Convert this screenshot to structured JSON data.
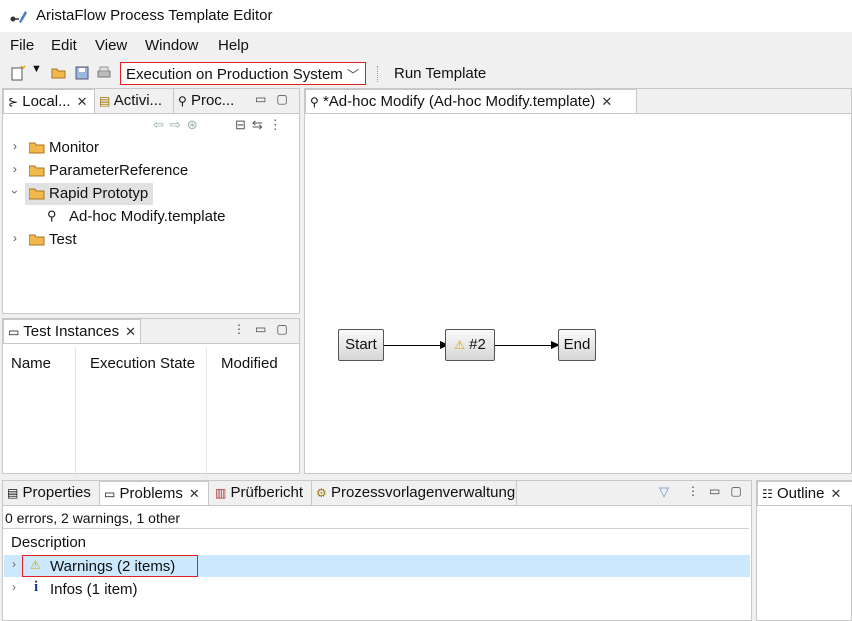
{
  "window": {
    "title": "AristaFlow Process Template Editor"
  },
  "menu": [
    "File",
    "Edit",
    "View",
    "Window",
    "Help"
  ],
  "toolbar": {
    "combo_value": "Execution on Production System",
    "run_template": "Run Template"
  },
  "left_panel": {
    "tabs": [
      "Local...",
      "Activi...",
      "Proc..."
    ],
    "tree": [
      {
        "label": "Monitor",
        "expanded": false
      },
      {
        "label": "ParameterReference",
        "expanded": false
      },
      {
        "label": "Rapid Prototyp",
        "expanded": true,
        "selected": true
      },
      {
        "label": "Ad-hoc Modify.template",
        "child": true
      },
      {
        "label": "Test",
        "expanded": false
      }
    ]
  },
  "test_instances": {
    "tab": "Test Instances",
    "columns": [
      "Name",
      "Execution State",
      "Modified"
    ]
  },
  "editor": {
    "tab": "*Ad-hoc Modify (Ad-hoc Modify.template)",
    "nodes": [
      "Start",
      "#2",
      "End"
    ]
  },
  "bottom_panel": {
    "tabs": [
      "Properties",
      "Problems",
      "Prüfbericht",
      "Prozessvorlagenverwaltung"
    ],
    "status": "0 errors, 2 warnings, 1 other",
    "column": "Description",
    "rows": [
      "Warnings (2 items)",
      "Infos (1 item)"
    ]
  },
  "outline": {
    "tab": "Outline"
  },
  "colors": {
    "highlight_border": "#dd2222",
    "selection": "#cce8ff",
    "warning": "#f0c000",
    "folder": "#f2b84b"
  }
}
